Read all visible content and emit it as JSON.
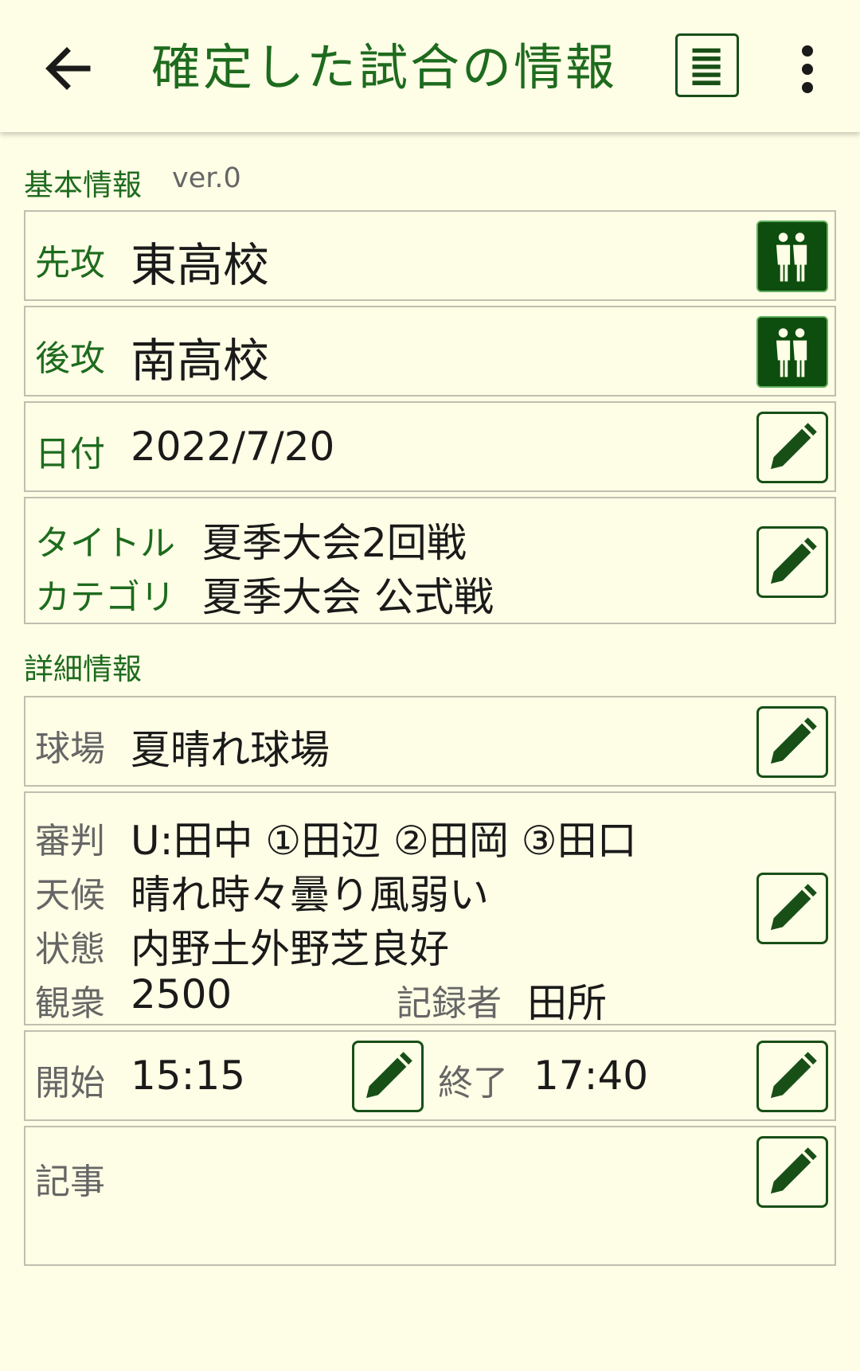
{
  "app_bar": {
    "title": "確定した試合の情報"
  },
  "basic_section": {
    "label": "基本情報",
    "version": "ver.0"
  },
  "first_attack": {
    "label": "先攻",
    "value": "東高校"
  },
  "second_attack": {
    "label": "後攻",
    "value": "南高校"
  },
  "date": {
    "label": "日付",
    "value": "2022/7/20"
  },
  "title_row": {
    "label": "タイトル",
    "value": "夏季大会2回戦"
  },
  "category_row": {
    "label": "カテゴリ",
    "value": "夏季大会 公式戦"
  },
  "detail_section": {
    "label": "詳細情報"
  },
  "stadium": {
    "label": "球場",
    "value": "夏晴れ球場"
  },
  "umpire": {
    "label": "審判",
    "value": "U:田中 ①田辺 ②田岡 ③田口"
  },
  "weather": {
    "label": "天候",
    "value": "晴れ時々曇り風弱い"
  },
  "condition": {
    "label": "状態",
    "value": "内野土外野芝良好"
  },
  "audience": {
    "label": "観衆",
    "value": "2500"
  },
  "recorder": {
    "label": "記録者",
    "value": "田所"
  },
  "start": {
    "label": "開始",
    "value": "15:15"
  },
  "end": {
    "label": "終了",
    "value": "17:40"
  },
  "article": {
    "label": "記事",
    "value": ""
  },
  "colors": {
    "background": "#fefee6",
    "accent_green": "#1e6b1e",
    "dark_green": "#0d4d0d"
  },
  "icons": {
    "back": "arrow-left-icon",
    "list": "list-icon",
    "more": "more-vert-icon",
    "team": "players-icon",
    "edit": "pencil-icon"
  }
}
